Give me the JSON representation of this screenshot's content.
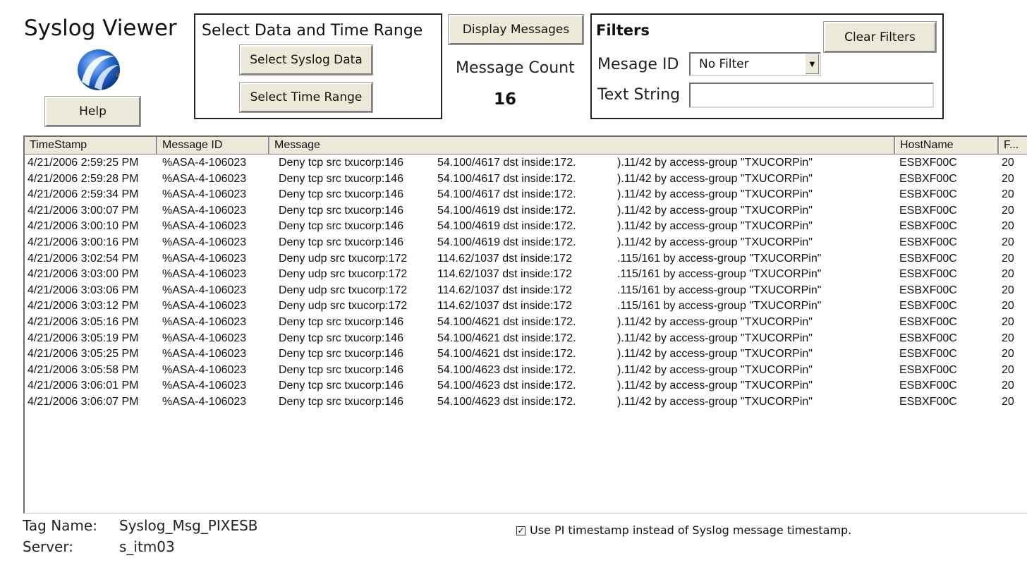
{
  "app": {
    "title": "Syslog Viewer",
    "help_label": "Help"
  },
  "range_panel": {
    "title": "Select Data and Time Range",
    "select_data_label": "Select Syslog Data",
    "select_time_label": "Select Time Range"
  },
  "display": {
    "display_label": "Display Messages",
    "count_label": "Message Count",
    "count_value": "16"
  },
  "filters": {
    "title": "Filters",
    "clear_label": "Clear Filters",
    "message_id_label": "Mesage ID",
    "message_id_value": "No Filter",
    "text_string_label": "Text String",
    "text_string_value": ""
  },
  "table": {
    "columns": [
      "TimeStamp",
      "Message ID",
      "Message",
      "HostName",
      "F..."
    ],
    "rows": [
      {
        "ts": "4/21/2006 2:59:25 PM",
        "id": "%ASA-4-106023",
        "m1": "Deny tcp src txucorp:146",
        "m2": "54.100/4617 dst inside:172.",
        "m3": ").11/42 by access-group \"TXUCORPin\"",
        "host": "ESBXF00C",
        "f": "20"
      },
      {
        "ts": "4/21/2006 2:59:28 PM",
        "id": "%ASA-4-106023",
        "m1": "Deny tcp src txucorp:146",
        "m2": "54.100/4617 dst inside:172.",
        "m3": ").11/42 by access-group \"TXUCORPin\"",
        "host": "ESBXF00C",
        "f": "20"
      },
      {
        "ts": "4/21/2006 2:59:34 PM",
        "id": "%ASA-4-106023",
        "m1": "Deny tcp src txucorp:146",
        "m2": "54.100/4617 dst inside:172.",
        "m3": ").11/42 by access-group \"TXUCORPin\"",
        "host": "ESBXF00C",
        "f": "20"
      },
      {
        "ts": "4/21/2006 3:00:07 PM",
        "id": "%ASA-4-106023",
        "m1": "Deny tcp src txucorp:146",
        "m2": "54.100/4619 dst inside:172.",
        "m3": ").11/42 by access-group \"TXUCORPin\"",
        "host": "ESBXF00C",
        "f": "20"
      },
      {
        "ts": "4/21/2006 3:00:10 PM",
        "id": "%ASA-4-106023",
        "m1": "Deny tcp src txucorp:146",
        "m2": "54.100/4619 dst inside:172.",
        "m3": ").11/42 by access-group \"TXUCORPin\"",
        "host": "ESBXF00C",
        "f": "20"
      },
      {
        "ts": "4/21/2006 3:00:16 PM",
        "id": "%ASA-4-106023",
        "m1": "Deny tcp src txucorp:146",
        "m2": "54.100/4619 dst inside:172.",
        "m3": ").11/42 by access-group \"TXUCORPin\"",
        "host": "ESBXF00C",
        "f": "20"
      },
      {
        "ts": "4/21/2006 3:02:54 PM",
        "id": "%ASA-4-106023",
        "m1": "Deny udp src txucorp:172",
        "m2": "114.62/1037 dst inside:172",
        "m3": ".115/161 by access-group \"TXUCORPin\"",
        "host": "ESBXF00C",
        "f": "20"
      },
      {
        "ts": "4/21/2006 3:03:00 PM",
        "id": "%ASA-4-106023",
        "m1": "Deny udp src txucorp:172",
        "m2": "114.62/1037 dst inside:172",
        "m3": ".115/161 by access-group \"TXUCORPin\"",
        "host": "ESBXF00C",
        "f": "20"
      },
      {
        "ts": "4/21/2006 3:03:06 PM",
        "id": "%ASA-4-106023",
        "m1": "Deny udp src txucorp:172",
        "m2": "114.62/1037 dst inside:172",
        "m3": ".115/161 by access-group \"TXUCORPin\"",
        "host": "ESBXF00C",
        "f": "20"
      },
      {
        "ts": "4/21/2006 3:03:12 PM",
        "id": "%ASA-4-106023",
        "m1": "Deny udp src txucorp:172",
        "m2": "114.62/1037 dst inside:172",
        "m3": ".115/161 by access-group \"TXUCORPin\"",
        "host": "ESBXF00C",
        "f": "20"
      },
      {
        "ts": "4/21/2006 3:05:16 PM",
        "id": "%ASA-4-106023",
        "m1": "Deny tcp src txucorp:146",
        "m2": "54.100/4621 dst inside:172.",
        "m3": ").11/42 by access-group \"TXUCORPin\"",
        "host": "ESBXF00C",
        "f": "20"
      },
      {
        "ts": "4/21/2006 3:05:19 PM",
        "id": "%ASA-4-106023",
        "m1": "Deny tcp src txucorp:146",
        "m2": "54.100/4621 dst inside:172.",
        "m3": ").11/42 by access-group \"TXUCORPin\"",
        "host": "ESBXF00C",
        "f": "20"
      },
      {
        "ts": "4/21/2006 3:05:25 PM",
        "id": "%ASA-4-106023",
        "m1": "Deny tcp src txucorp:146",
        "m2": "54.100/4621 dst inside:172.",
        "m3": ").11/42 by access-group \"TXUCORPin\"",
        "host": "ESBXF00C",
        "f": "20"
      },
      {
        "ts": "4/21/2006 3:05:58 PM",
        "id": "%ASA-4-106023",
        "m1": "Deny tcp src txucorp:146",
        "m2": "54.100/4623 dst inside:172.",
        "m3": ").11/42 by access-group \"TXUCORPin\"",
        "host": "ESBXF00C",
        "f": "20"
      },
      {
        "ts": "4/21/2006 3:06:01 PM",
        "id": "%ASA-4-106023",
        "m1": "Deny tcp src txucorp:146",
        "m2": "54.100/4623 dst inside:172.",
        "m3": ").11/42 by access-group \"TXUCORPin\"",
        "host": "ESBXF00C",
        "f": "20"
      },
      {
        "ts": "4/21/2006 3:06:07 PM",
        "id": "%ASA-4-106023",
        "m1": "Deny tcp src txucorp:146",
        "m2": "54.100/4623 dst inside:172.",
        "m3": ").11/42 by access-group \"TXUCORPin\"",
        "host": "ESBXF00C",
        "f": "20"
      }
    ]
  },
  "footer": {
    "tag_label": "Tag Name:",
    "tag_value": "Syslog_Msg_PIXESB",
    "server_label": "Server:",
    "server_value": "s_itm03",
    "pi_timestamp_checked": true,
    "pi_timestamp_label": "Use PI timestamp instead of Syslog message timestamp."
  },
  "icons": {
    "logo": "logo-icon",
    "dropdown": "chevron-down-icon",
    "checkbox": "checkbox-checked-icon"
  }
}
